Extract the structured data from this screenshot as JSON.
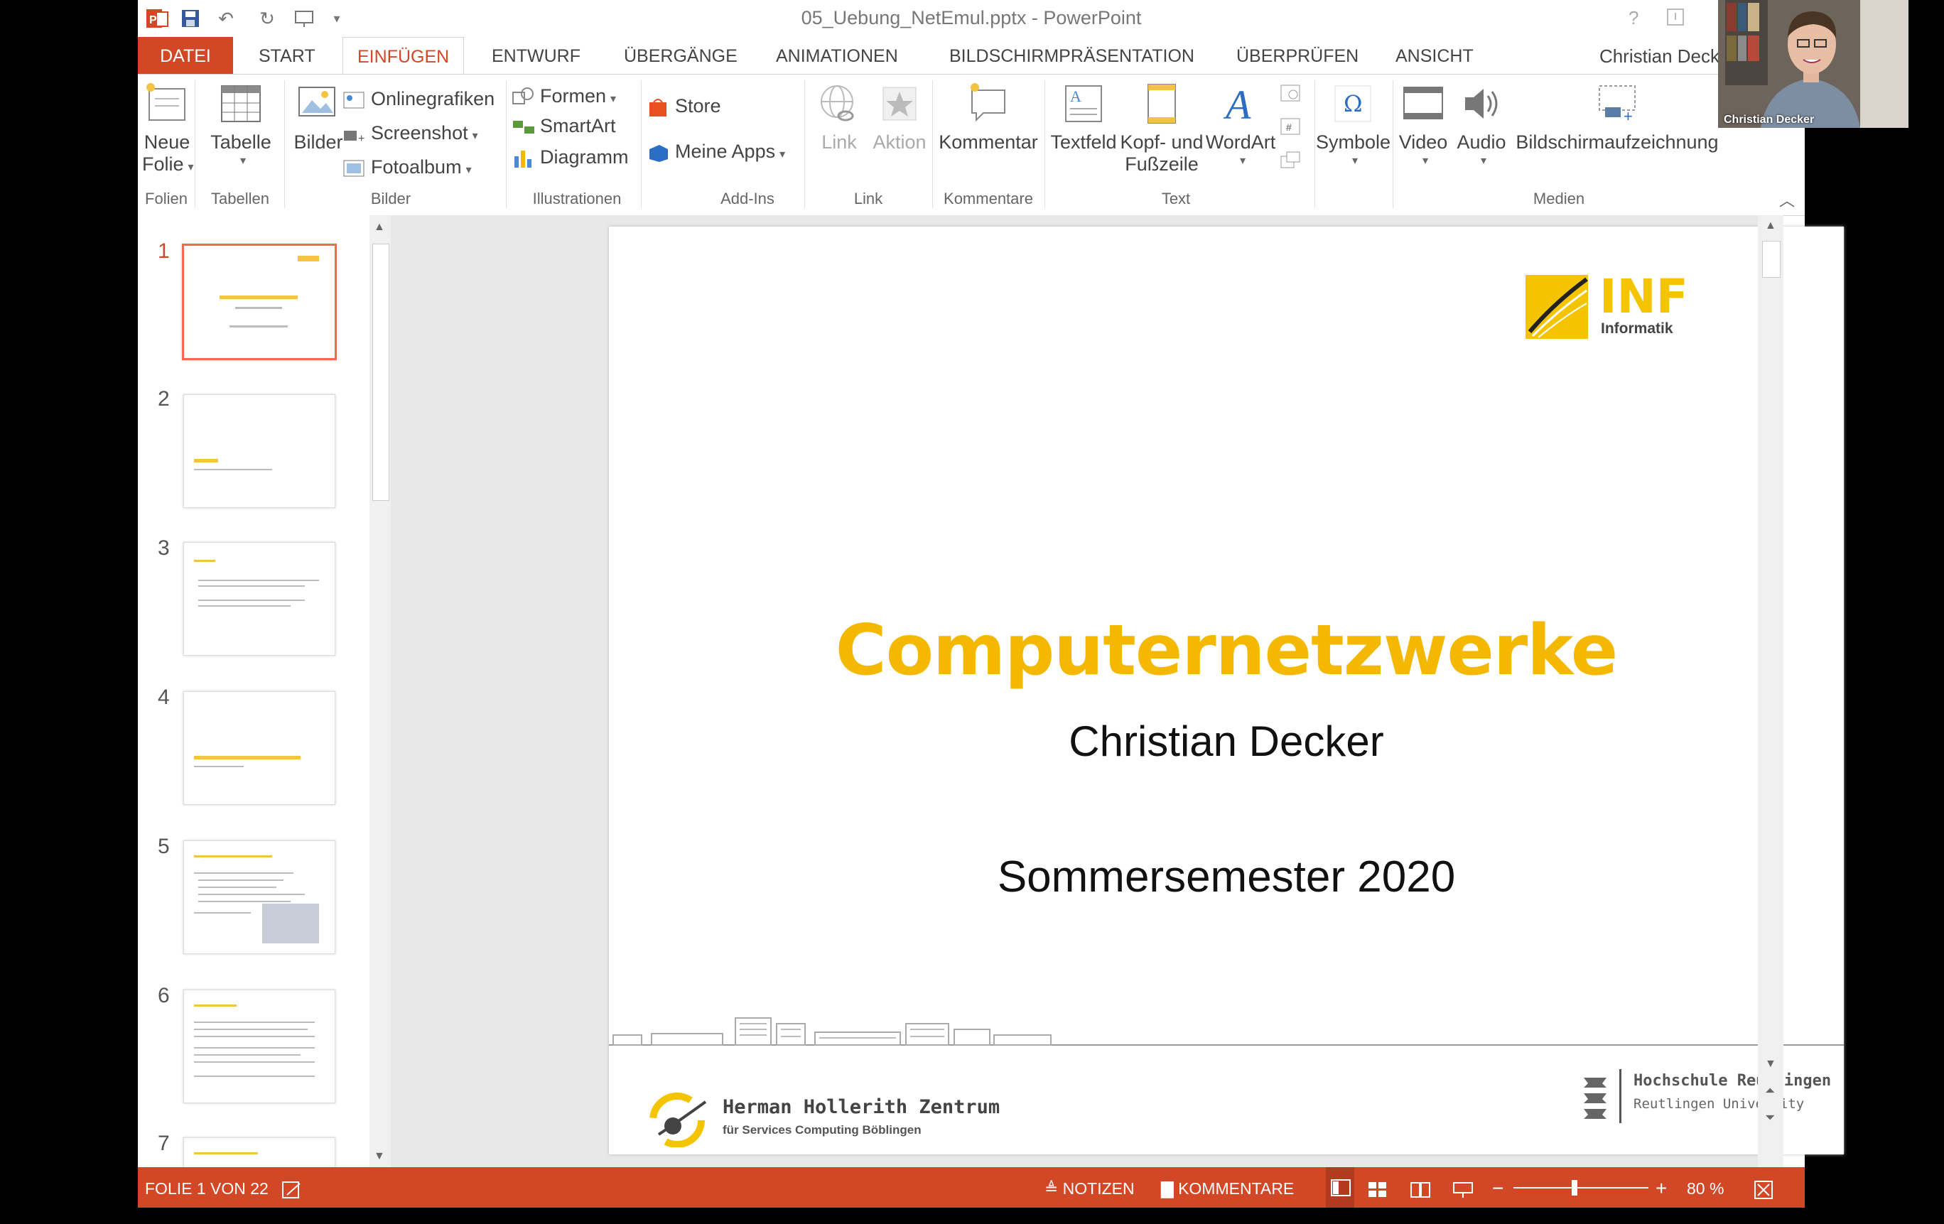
{
  "window": {
    "title": "05_Uebung_NetEmul.pptx - PowerPoint",
    "help": "?"
  },
  "tabs": {
    "file": "DATEI",
    "items": [
      "START",
      "EINFÜGEN",
      "ENTWURF",
      "ÜBERGÄNGE",
      "ANIMATIONEN",
      "BILDSCHIRMPRÄSENTATION",
      "ÜBERPRÜFEN",
      "ANSICHT"
    ],
    "active": "EINFÜGEN",
    "user": "Christian Deck"
  },
  "ribbon": {
    "neue_folie": [
      "Neue",
      "Folie"
    ],
    "tabelle": "Tabelle",
    "bilder": "Bilder",
    "onlinegrafiken": "Onlinegrafiken",
    "screenshot": "Screenshot",
    "fotoalbum": "Fotoalbum",
    "formen": "Formen",
    "smartart": "SmartArt",
    "diagramm": "Diagramm",
    "store": "Store",
    "meine_apps": "Meine Apps",
    "link": "Link",
    "aktion": "Aktion",
    "kommentar": "Kommentar",
    "textfeld": "Textfeld",
    "kopf_fuss": [
      "Kopf- und",
      "Fußzeile"
    ],
    "wordart": "WordArt",
    "symbole": "Symbole",
    "video": "Video",
    "audio": "Audio",
    "bildschirmaufzeichnung": "Bildschirmaufzeichnung",
    "groups": {
      "folien": "Folien",
      "tabellen": "Tabellen",
      "bilder": "Bilder",
      "illustrationen": "Illustrationen",
      "addins": "Add-Ins",
      "link": "Link",
      "kommentare": "Kommentare",
      "text": "Text",
      "medien": "Medien"
    }
  },
  "thumbnails": {
    "numbers": [
      "1",
      "2",
      "3",
      "4",
      "5",
      "6",
      "7"
    ],
    "selected": "1"
  },
  "slide": {
    "title": "Computernetzwerke",
    "author": "Christian Decker",
    "term": "Sommersemester 2020",
    "logo_text": "INF",
    "logo_sub": "Informatik",
    "footer_left_title": "Herman Hollerith Zentrum",
    "footer_left_sub": "für Services Computing Böblingen",
    "footer_right_title": "Hochschule Reutlingen",
    "footer_right_sub": "Reutlingen University"
  },
  "status": {
    "slide_info": "FOLIE 1 VON 22",
    "notes": "NOTIZEN",
    "comments": "KOMMENTARE",
    "zoom": "80 %"
  },
  "webcam": {
    "name": "Christian Decker"
  },
  "colors": {
    "accent": "#d24726",
    "title_yellow": "#f5b800"
  }
}
